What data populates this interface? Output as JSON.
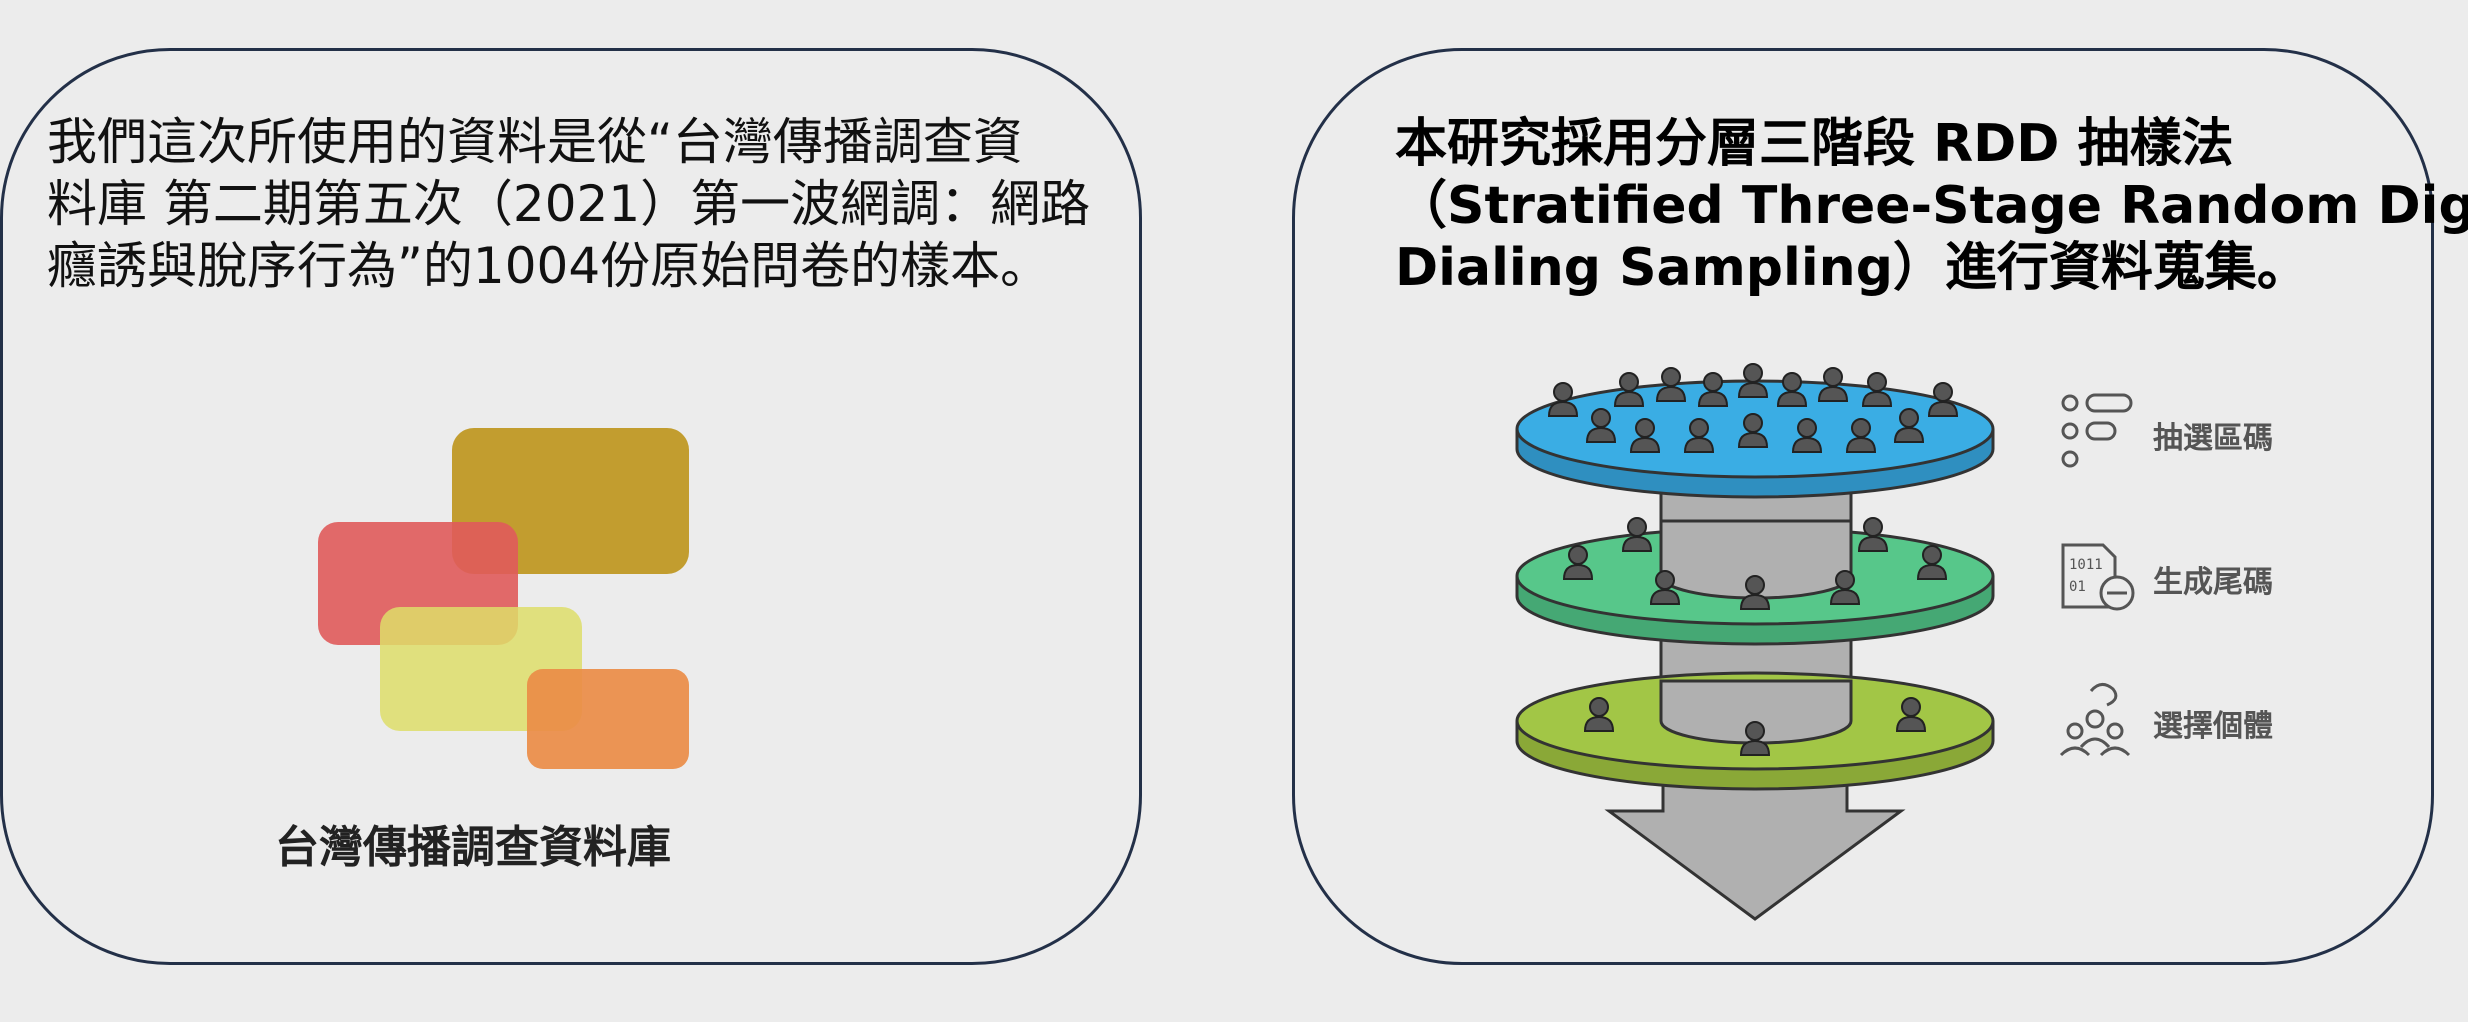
{
  "left_panel": {
    "paragraph": [
      "我們這次所使用的資料是從“台灣傳播調查資",
      "料庫 第二期第五次（2021）第一波網調：網路",
      "癮誘與脫序行為”的1004份原始問卷的樣本。"
    ],
    "logo_caption": "台灣傳播調查資料庫",
    "logo_colors": {
      "gold": "#c09a28",
      "red": "#e05b5b",
      "yellow": "#dede6a",
      "orange": "#ea8c46"
    }
  },
  "right_panel": {
    "heading_lines": [
      "本研究採用分層三階段 RDD 抽樣法",
      "（Stratified Three-Stage Random Digit",
      "Dialing Sampling）進行資料蒐集。"
    ],
    "stages": [
      {
        "label": "抽選區碼",
        "icon": "list-icon",
        "color": "#3aade4"
      },
      {
        "label": "生成尾碼",
        "icon": "binary-file-icon",
        "color": "#57c78a"
      },
      {
        "label": "選擇個體",
        "icon": "group-selection-icon",
        "color": "#a2c646"
      }
    ],
    "core_color": "#b0b0b0",
    "person_color": "#555555"
  }
}
